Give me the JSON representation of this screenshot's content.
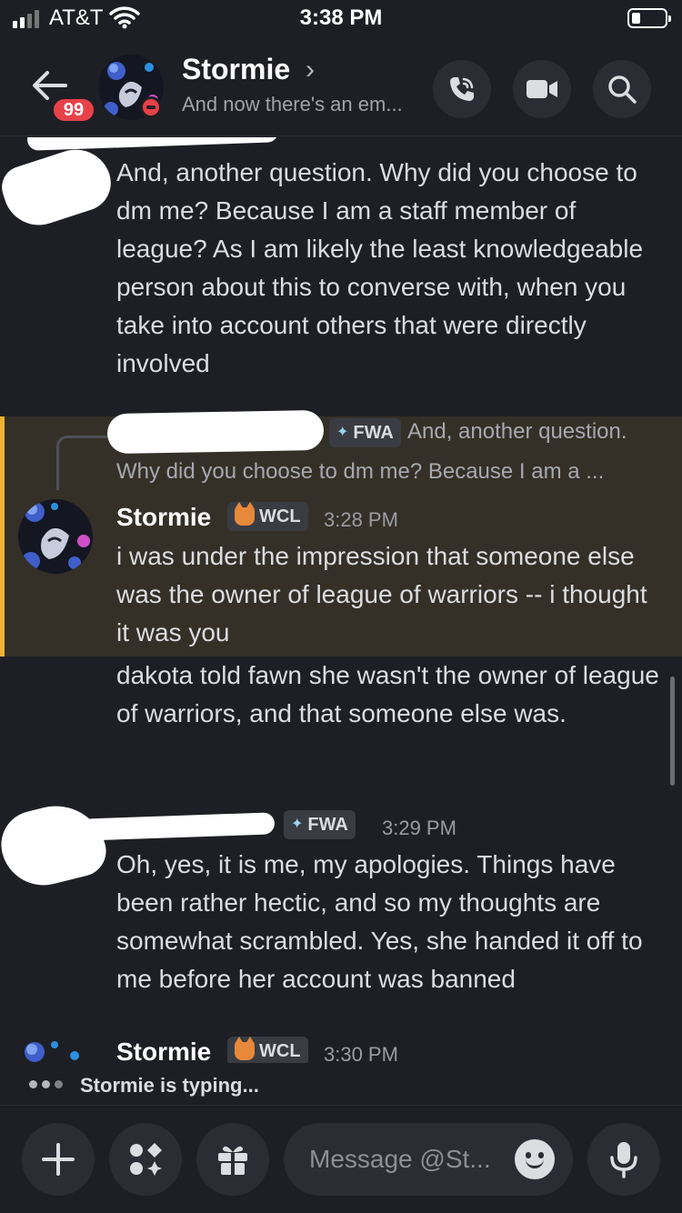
{
  "status_bar": {
    "carrier": "AT&T",
    "time": "3:38 PM"
  },
  "header": {
    "unread_count": "99",
    "name": "Stormie",
    "chevron": "›",
    "status": "And now there's an em..."
  },
  "messages": [
    {
      "text": "And, another question. Why did you choose to dm me? Because I am a staff member of league? As I am likely the least knowledgeable person about this to converse with, when you take into account others that were directly involved"
    },
    {
      "reply_tag": "FWA",
      "reply_preview_line1": "And, another question.",
      "reply_preview_line2": "Why did you choose to dm me? Because I am a ...",
      "author": "Stormie",
      "tag": "WCL",
      "time": "3:28 PM",
      "text": "i was under the impression that someone else was the owner of league of warriors -- i thought it was you"
    },
    {
      "text": "dakota told fawn she wasn't the owner of league of warriors, and that someone else was."
    },
    {
      "tag": "FWA",
      "time": "3:29 PM",
      "text": "Oh, yes, it is me, my apologies. Things have been rather hectic, and so my thoughts are somewhat scrambled. Yes, she handed it off to me before her account was banned"
    },
    {
      "author": "Stormie",
      "tag": "WCL",
      "time": "3:30 PM"
    }
  ],
  "typing": {
    "text": "Stormie is typing..."
  },
  "composer": {
    "placeholder": "Message @St..."
  },
  "colors": {
    "background": "#1e1f24",
    "highlight": "#343028",
    "highlight_border": "#f0b232",
    "badge": "#e8414a"
  },
  "icons": [
    "back-arrow-icon",
    "phone-call-icon",
    "video-camera-icon",
    "search-icon",
    "plus-icon",
    "apps-icon",
    "gift-icon",
    "emoji-icon",
    "microphone-icon"
  ]
}
